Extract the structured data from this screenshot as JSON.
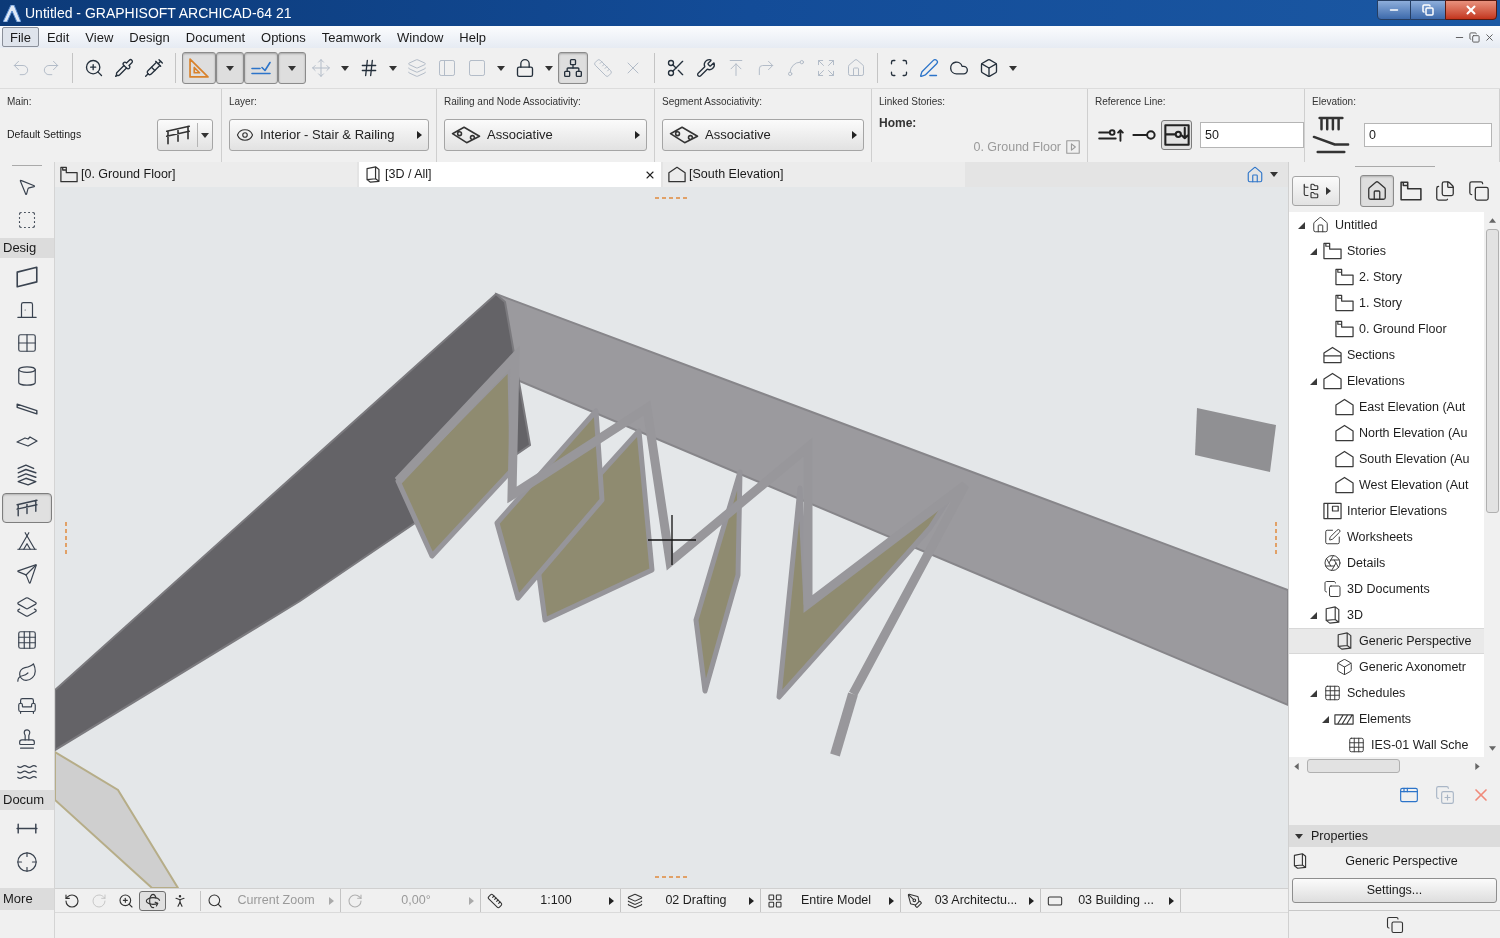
{
  "window": {
    "title": "Untitled - GRAPHISOFT ARCHICAD-64 21"
  },
  "menu": [
    {
      "label": "File",
      "selected": true
    },
    {
      "label": "Edit",
      "selected": false
    },
    {
      "label": "View",
      "selected": false
    },
    {
      "label": "Design",
      "selected": false
    },
    {
      "label": "Document",
      "selected": false
    },
    {
      "label": "Options",
      "selected": false
    },
    {
      "label": "Teamwork",
      "selected": false
    },
    {
      "label": "Window",
      "selected": false
    },
    {
      "label": "Help",
      "selected": false
    }
  ],
  "toolbar": [
    {
      "pressed": false,
      "disabled": true
    },
    {
      "pressed": false,
      "disabled": true
    },
    {
      "pressed": false,
      "disabled": false
    },
    {
      "pressed": false,
      "disabled": false
    },
    {
      "pressed": false,
      "disabled": false
    },
    {
      "pressed": true,
      "disabled": false
    },
    {
      "pressed": true,
      "disabled": false
    },
    {
      "pressed": false,
      "disabled": true
    },
    {
      "pressed": false,
      "disabled": false
    },
    {
      "pressed": false,
      "disabled": true
    },
    {
      "pressed": false,
      "disabled": true
    },
    {
      "pressed": false,
      "disabled": true
    },
    {
      "pressed": false,
      "disabled": false
    },
    {
      "pressed": true,
      "disabled": false
    },
    {
      "pressed": false,
      "disabled": true
    },
    {
      "pressed": false,
      "disabled": true
    },
    {
      "pressed": false,
      "disabled": false
    },
    {
      "pressed": false,
      "disabled": false
    },
    {
      "pressed": false,
      "disabled": true
    },
    {
      "pressed": false,
      "disabled": true
    },
    {
      "pressed": false,
      "disabled": true
    },
    {
      "pressed": false,
      "disabled": true
    },
    {
      "pressed": false,
      "disabled": true
    },
    {
      "pressed": false,
      "disabled": false
    },
    {
      "pressed": false,
      "disabled": false
    },
    {
      "pressed": false,
      "disabled": false
    },
    {
      "pressed": false,
      "disabled": false
    }
  ],
  "info_box": {
    "main": {
      "label": "Main:",
      "value": "Default Settings"
    },
    "layer": {
      "label": "Layer:",
      "value": "Interior - Stair & Railing"
    },
    "railing_node": {
      "label": "Railing and Node Associativity:",
      "value": "Associative"
    },
    "segment": {
      "label": "Segment Associativity:",
      "value": "Associative"
    },
    "linked_stories": {
      "label": "Linked Stories:",
      "home_label": "Home:",
      "home_value": "0. Ground Floor",
      "disabled": true
    },
    "reference_line": {
      "label": "Reference Line:",
      "options": [
        {
          "selected": false
        },
        {
          "selected": false
        },
        {
          "selected": true
        }
      ],
      "value": "50"
    },
    "elevation": {
      "label": "Elevation:",
      "value": "0"
    }
  },
  "view_tabs": [
    {
      "label": "[0. Ground Floor]",
      "selected": false
    },
    {
      "label": "[3D / All]",
      "selected": true
    },
    {
      "label": "[South Elevation]",
      "selected": false
    }
  ],
  "toolbox": {
    "tools": [
      {
        "selected": false
      },
      {
        "selected": false
      }
    ],
    "sections": [
      {
        "label": "Desig",
        "tools": [
          {
            "selected": false
          },
          {
            "selected": false
          },
          {
            "selected": false
          },
          {
            "selected": false
          },
          {
            "selected": false
          },
          {
            "selected": false
          },
          {
            "selected": false
          },
          {
            "selected": true
          },
          {
            "selected": false
          },
          {
            "selected": false
          },
          {
            "selected": false
          },
          {
            "selected": false
          },
          {
            "selected": false
          },
          {
            "selected": false
          },
          {
            "selected": false
          },
          {
            "selected": false
          }
        ]
      },
      {
        "label": "Docum",
        "tools": [
          {
            "selected": false
          },
          {
            "selected": false
          }
        ]
      }
    ],
    "more": "More"
  },
  "navigator": {
    "views": [
      {
        "selected": true
      },
      {
        "selected": false
      },
      {
        "selected": false
      },
      {
        "selected": false
      }
    ],
    "tree": [
      {
        "label": "Untitled",
        "kind": "project",
        "expanded": true,
        "selected": false,
        "children": [
          {
            "label": "Stories",
            "kind": "stories",
            "expanded": true,
            "selected": false,
            "children": [
              {
                "label": "2. Story",
                "kind": "story",
                "selected": false
              },
              {
                "label": "1. Story",
                "kind": "story",
                "selected": false
              },
              {
                "label": "0. Ground Floor",
                "kind": "story",
                "selected": false
              }
            ]
          },
          {
            "label": "Sections",
            "kind": "sections",
            "selected": false
          },
          {
            "label": "Elevations",
            "kind": "elevations",
            "expanded": true,
            "selected": false,
            "children": [
              {
                "label": "East Elevation (Aut",
                "kind": "elevation",
                "selected": false
              },
              {
                "label": "North Elevation (Au",
                "kind": "elevation",
                "selected": false
              },
              {
                "label": "South Elevation (Au",
                "kind": "elevation",
                "selected": false
              },
              {
                "label": "West Elevation (Aut",
                "kind": "elevation",
                "selected": false
              }
            ]
          },
          {
            "label": "Interior Elevations",
            "kind": "interior",
            "selected": false
          },
          {
            "label": "Worksheets",
            "kind": "worksheets",
            "selected": false
          },
          {
            "label": "Details",
            "kind": "details",
            "selected": false
          },
          {
            "label": "3D Documents",
            "kind": "documents",
            "selected": false
          },
          {
            "label": "3D",
            "kind": "model",
            "expanded": true,
            "selected": false,
            "children": [
              {
                "label": "Generic Perspective",
                "kind": "perspective",
                "selected": true
              },
              {
                "label": "Generic Axonometr",
                "kind": "axonometry",
                "selected": false
              }
            ]
          },
          {
            "label": "Schedules",
            "kind": "schedules",
            "expanded": true,
            "selected": false,
            "children": [
              {
                "label": "Elements",
                "kind": "elements",
                "expanded": true,
                "selected": false,
                "children": [
                  {
                    "label": "IES-01 Wall Sche",
                    "kind": "schedule",
                    "selected": false
                  }
                ]
              }
            ]
          }
        ]
      }
    ],
    "properties": {
      "title": "Properties",
      "expanded": true,
      "name": "Generic Perspective",
      "button": "Settings..."
    }
  },
  "status_bar": {
    "nav_buttons": [
      {
        "pressed": false,
        "disabled": false
      },
      {
        "pressed": false,
        "disabled": true
      },
      {
        "pressed": false,
        "disabled": false
      },
      {
        "pressed": true,
        "disabled": false
      },
      {
        "pressed": false,
        "disabled": false
      }
    ],
    "items": [
      {
        "label": "Current Zoom",
        "disabled": true
      },
      {
        "label": "0,00°",
        "disabled": true
      },
      {
        "label": "1:100",
        "disabled": false
      },
      {
        "label": "02 Drafting",
        "disabled": false
      },
      {
        "label": "Entire Model",
        "disabled": false
      },
      {
        "label": "03 Architectu...",
        "disabled": false
      },
      {
        "label": "03 Building ...",
        "disabled": false
      }
    ]
  }
}
